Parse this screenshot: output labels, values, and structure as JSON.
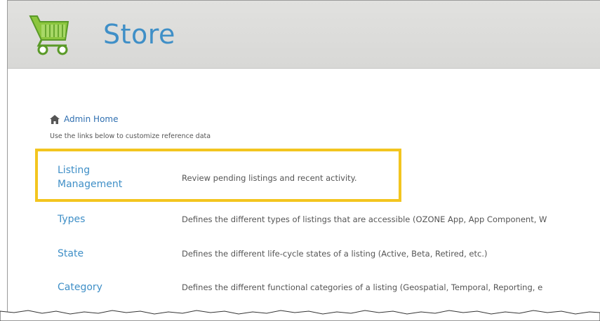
{
  "header": {
    "title": "Store",
    "logo_icon": "shopping-cart-icon",
    "accent": "#3f8fc7"
  },
  "breadcrumb": {
    "icon": "home-icon",
    "label": "Admin Home"
  },
  "subtitle": "Use the links below to customize reference data",
  "rows": [
    {
      "label_line1": "Listing",
      "label_line2": "Management",
      "description": "Review pending listings and recent activity."
    },
    {
      "label": "Types",
      "description": "Defines the different types of listings that are accessible (OZONE App, App Component, W"
    },
    {
      "label": "State",
      "description": "Defines the different life-cycle states of a listing (Active, Beta, Retired, etc.)"
    },
    {
      "label": "Category",
      "description": "Defines the different functional categories of a listing (Geospatial, Temporal, Reporting, e"
    }
  ],
  "highlight_color": "#f3c51f"
}
